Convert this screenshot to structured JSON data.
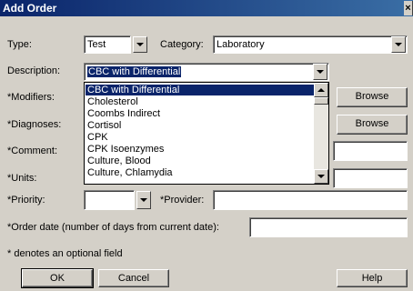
{
  "window": {
    "title": "Add Order",
    "close_glyph": "×"
  },
  "type": {
    "label": "Type:",
    "value": "Test"
  },
  "category": {
    "label": "Category:",
    "value": "Laboratory"
  },
  "description": {
    "label": "Description:",
    "value": "CBC with Differential",
    "options": [
      "CBC with Differential",
      "Cholesterol",
      "Coombs Indirect",
      "Cortisol",
      "CPK",
      "CPK Isoenzymes",
      "Culture, Blood",
      "Culture, Chlamydia"
    ]
  },
  "modifiers": {
    "label": "*Modifiers:",
    "browse_label": "Browse"
  },
  "diagnoses": {
    "label": "*Diagnoses:",
    "browse_label": "Browse"
  },
  "comment": {
    "label": "*Comment:"
  },
  "units": {
    "label": "*Units:"
  },
  "priority": {
    "label": "*Priority:"
  },
  "provider": {
    "label": "*Provider:"
  },
  "order_date": {
    "label": "*Order date (number of days from current date):"
  },
  "footnote": "* denotes an optional field",
  "buttons": {
    "ok": "OK",
    "cancel": "Cancel",
    "help": "Help"
  }
}
